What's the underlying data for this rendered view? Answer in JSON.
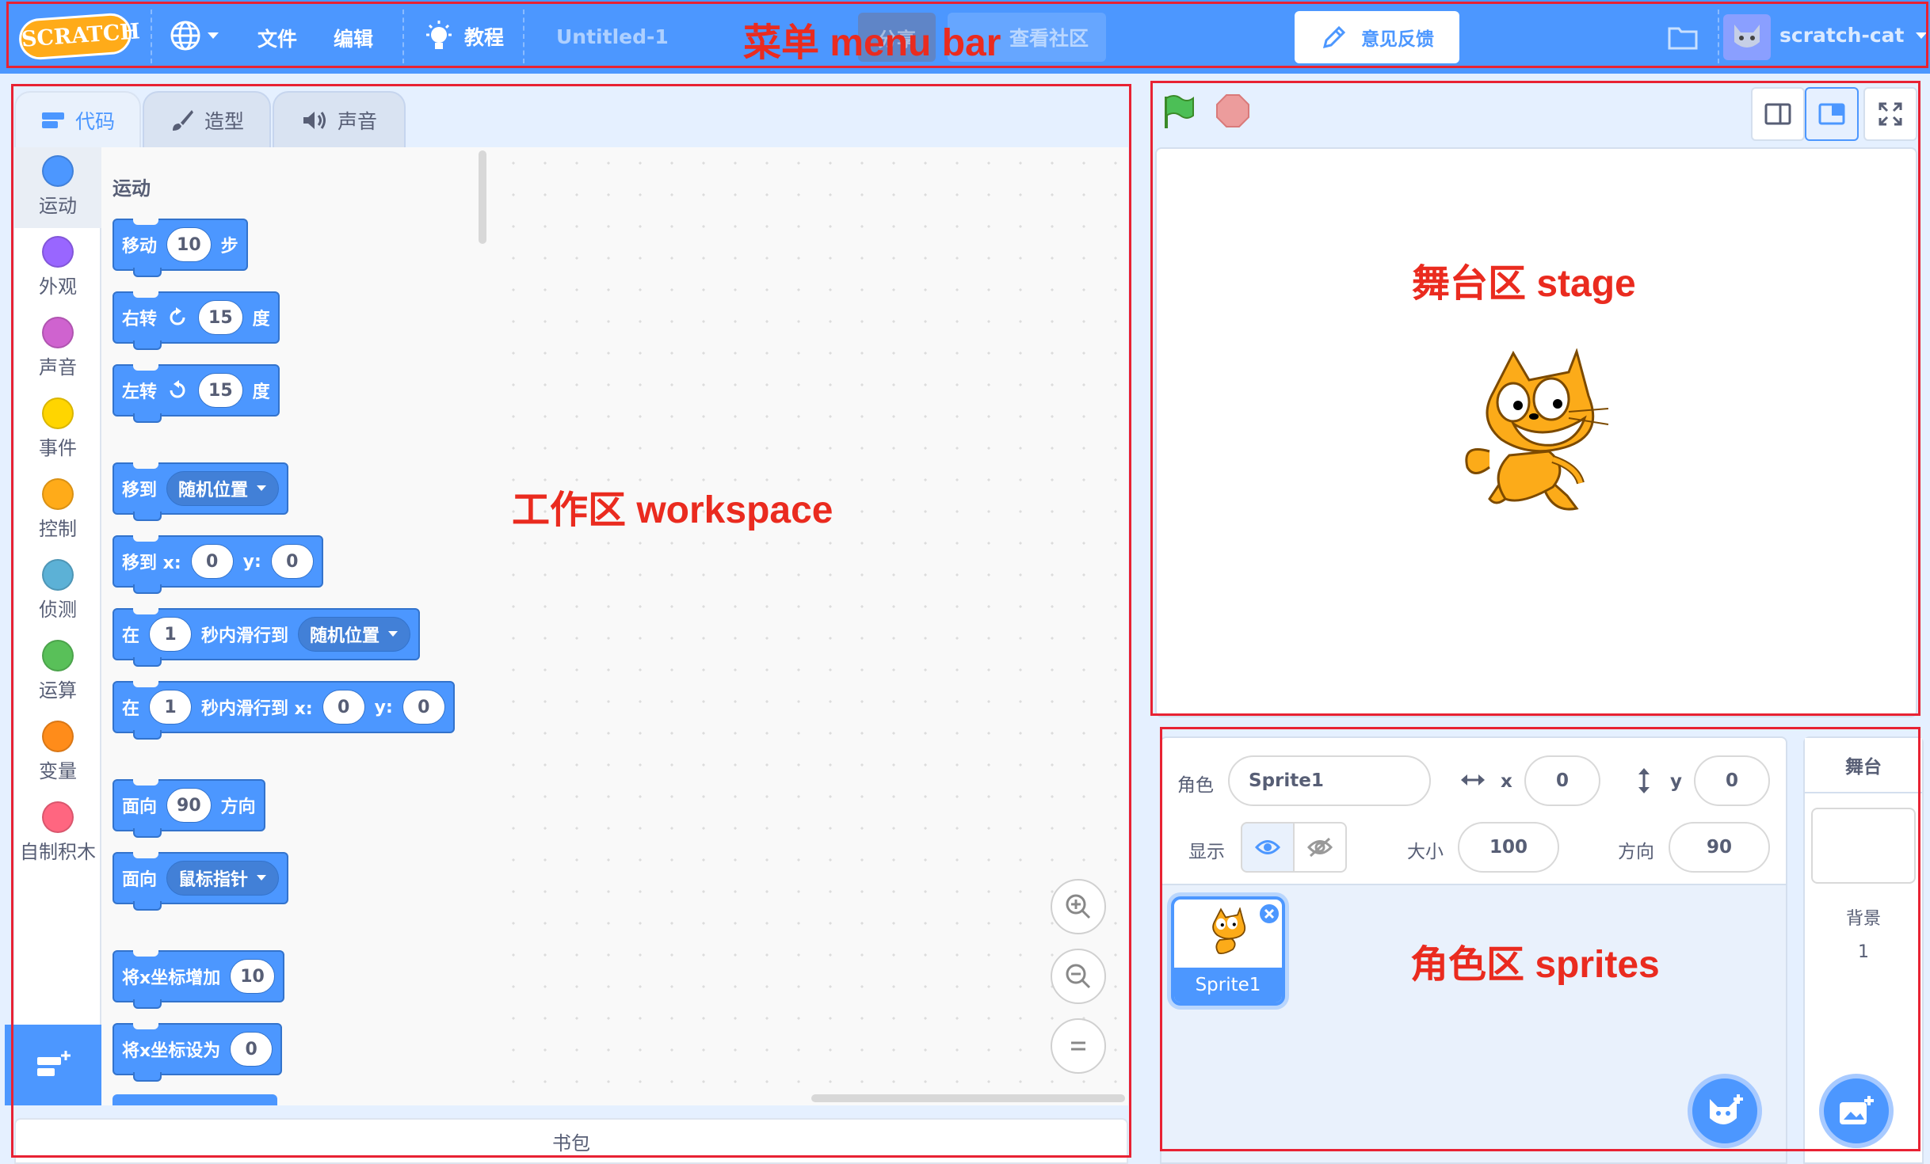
{
  "menubar": {
    "logo": "SCRATCH",
    "file": "文件",
    "edit": "编辑",
    "tutorials": "教程",
    "project_title": "Untitled-1",
    "share": "分享",
    "see_community": "查看社区",
    "feedback": "意见反馈",
    "username": "scratch-cat"
  },
  "tabs": [
    {
      "label": "代码"
    },
    {
      "label": "造型"
    },
    {
      "label": "声音"
    }
  ],
  "categories": [
    {
      "label": "运动",
      "color": "#4c97ff"
    },
    {
      "label": "外观",
      "color": "#9966ff"
    },
    {
      "label": "声音",
      "color": "#cf63cf"
    },
    {
      "label": "事件",
      "color": "#ffd500"
    },
    {
      "label": "控制",
      "color": "#ffab19"
    },
    {
      "label": "侦测",
      "color": "#5cb1d6"
    },
    {
      "label": "运算",
      "color": "#59c059"
    },
    {
      "label": "变量",
      "color": "#ff8c1a"
    },
    {
      "label": "自制积木",
      "color": "#ff6680"
    }
  ],
  "palette": {
    "heading": "运动",
    "blocks": {
      "move": {
        "t1": "移动",
        "v1": "10",
        "t2": "步"
      },
      "turn_right": {
        "t1": "右转",
        "v1": "15",
        "t2": "度"
      },
      "turn_left": {
        "t1": "左转",
        "v1": "15",
        "t2": "度"
      },
      "goto": {
        "t1": "移到",
        "d1": "随机位置"
      },
      "goto_xy": {
        "t1": "移到 x:",
        "v1": "0",
        "t2": "y:",
        "v2": "0"
      },
      "glide": {
        "t1": "在",
        "v1": "1",
        "t2": "秒内滑行到",
        "d1": "随机位置"
      },
      "glide_xy": {
        "t1": "在",
        "v1": "1",
        "t2": "秒内滑行到 x:",
        "v2": "0",
        "t3": "y:",
        "v3": "0"
      },
      "point_dir": {
        "t1": "面向",
        "v1": "90",
        "t2": "方向"
      },
      "point_towards": {
        "t1": "面向",
        "d1": "鼠标指针"
      },
      "change_x": {
        "t1": "将x坐标增加",
        "v1": "10"
      },
      "set_x": {
        "t1": "将x坐标设为",
        "v1": "0"
      }
    }
  },
  "backpack": "书包",
  "sprite_info": {
    "sprite_label": "角色",
    "sprite_name": "Sprite1",
    "x_label": "x",
    "x_value": "0",
    "y_label": "y",
    "y_value": "0",
    "show_label": "显示",
    "size_label": "大小",
    "size_value": "100",
    "direction_label": "方向",
    "direction_value": "90"
  },
  "sprites": [
    {
      "name": "Sprite1"
    }
  ],
  "stage_panel": {
    "title": "舞台",
    "backdrops_label": "背景",
    "backdrops_count": "1"
  },
  "annotations": {
    "menu_bar": "菜单 menu bar",
    "workspace": "工作区 workspace",
    "stage": "舞台区 stage",
    "sprites": "角色区 sprites"
  }
}
